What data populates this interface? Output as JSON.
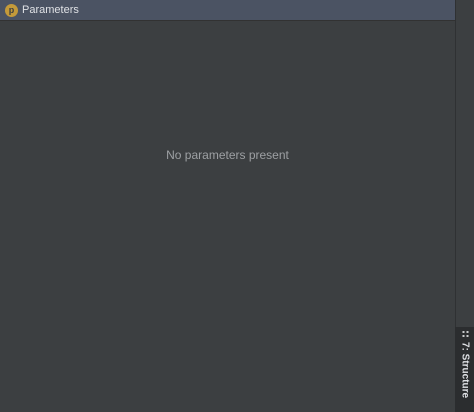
{
  "panel": {
    "title": "Parameters",
    "icon_letter": "p",
    "icon": "parameter-p-icon"
  },
  "content": {
    "empty_message": "No parameters present"
  },
  "side_tabs": {
    "structure_label": "7: Structure",
    "structure_icon": "structure-icon"
  },
  "colors": {
    "background": "#3c3f41",
    "titlebar": "#4b5363",
    "icon_accent": "#c49a3a",
    "text_muted": "#9da0a3"
  }
}
